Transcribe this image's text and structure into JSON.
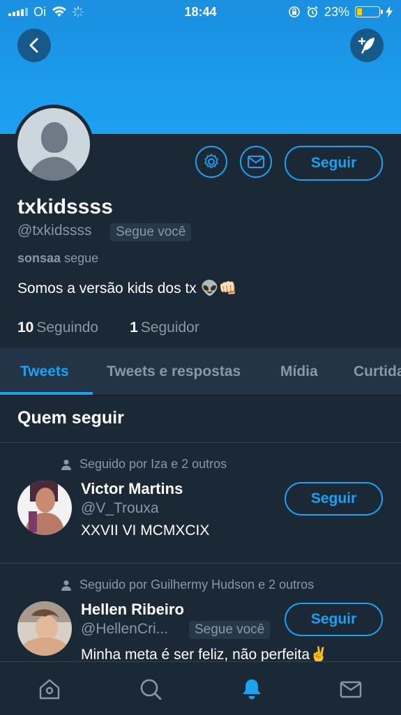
{
  "status_bar": {
    "carrier": "Oi",
    "time": "18:44",
    "battery_percent": "23%",
    "battery_level": 0.23
  },
  "profile": {
    "display_name": "txkidssss",
    "handle": "@txkidssss",
    "follows_you_badge": "Segue você",
    "followed_by_user": "sonsaa",
    "followed_by_suffix": "segue",
    "bio": "Somos a versão kids dos tx 👽👊🏻",
    "following_count": "10",
    "following_label": "Seguindo",
    "followers_count": "1",
    "followers_label": "Seguidor",
    "follow_button": "Seguir"
  },
  "tabs": [
    {
      "label": "Tweets",
      "active": true
    },
    {
      "label": "Tweets e respostas",
      "active": false
    },
    {
      "label": "Mídia",
      "active": false
    },
    {
      "label": "Curtidas",
      "active": false
    }
  ],
  "who_to_follow": {
    "title": "Quem seguir",
    "items": [
      {
        "context": "Seguido por Iza e 2 outros",
        "name": "Victor Martins",
        "handle": "@V_Trouxa",
        "bio": "XXVII VI MCMXCIX",
        "button": "Seguir"
      },
      {
        "context": "Seguido por Guilhermy Hudson e 2 outros",
        "name": "Hellen Ribeiro",
        "handle": "@HellenCri...",
        "badge": "Segue você",
        "bio": "Minha meta é ser feliz, não perfeita✌️",
        "button": "Seguir"
      }
    ]
  },
  "bottom_nav": [
    "home-icon",
    "search-icon",
    "notifications-icon",
    "messages-icon"
  ],
  "colors": {
    "accent": "#1da1f2",
    "background": "#1b2836",
    "secondary_text": "#8899a6"
  }
}
